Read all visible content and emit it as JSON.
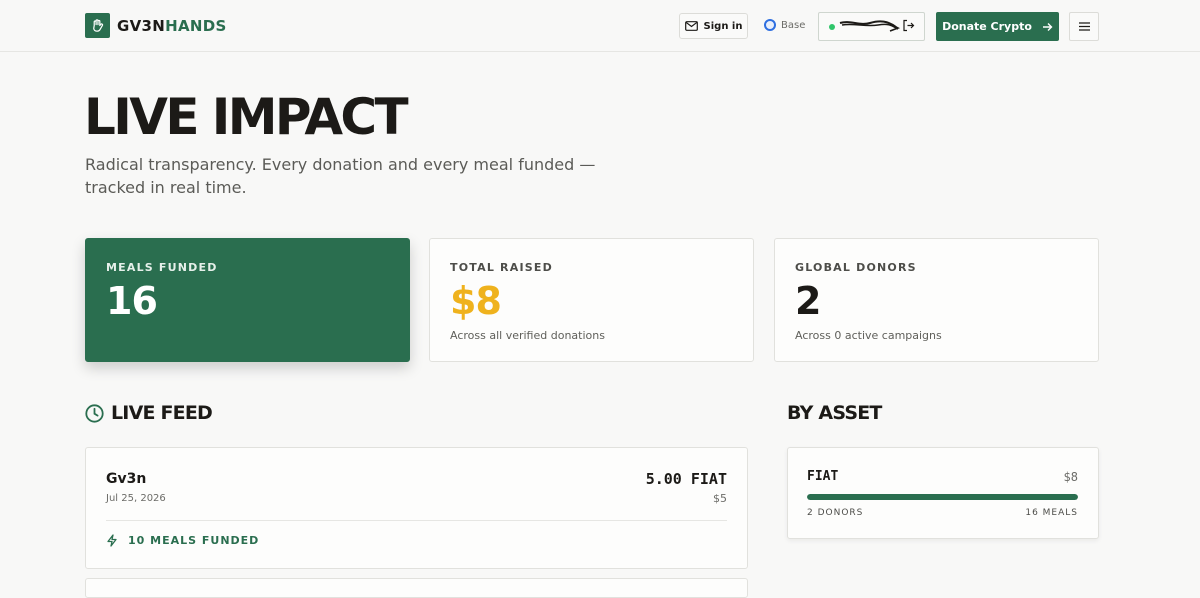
{
  "header": {
    "logo_prefix": "GV3N",
    "logo_suffix": "HANDS",
    "signin_label": "Sign in",
    "network_label": "Base",
    "donate_label": "Donate Crypto"
  },
  "hero": {
    "title": "LIVE IMPACT",
    "subtitle": "Radical transparency. Every donation and every meal funded — tracked in real time."
  },
  "stats": [
    {
      "label": "MEALS FUNDED",
      "value": "16",
      "note": ""
    },
    {
      "label": "TOTAL RAISED",
      "value": "$8",
      "note": "Across all verified donations"
    },
    {
      "label": "GLOBAL DONORS",
      "value": "2",
      "note": "Across 0 active campaigns"
    }
  ],
  "feed": {
    "title": "LIVE FEED",
    "items": [
      {
        "name": "Gv3n",
        "date": "Jul 25, 2026",
        "amount": "5.00 FIAT",
        "usd": "$5",
        "meals": "10 MEALS FUNDED"
      }
    ]
  },
  "by_asset": {
    "title": "BY ASSET",
    "items": [
      {
        "asset": "FIAT",
        "amount": "$8",
        "share": 1.0,
        "donors": "2 DONORS",
        "meals": "16 MEALS"
      }
    ]
  },
  "colors": {
    "brand_green": "#2a6e4f",
    "accent_gold": "#efb21d",
    "text_dark": "#1c1a17",
    "wallet_status": "#2fc56a",
    "network_blue": "#2f6fe0"
  }
}
